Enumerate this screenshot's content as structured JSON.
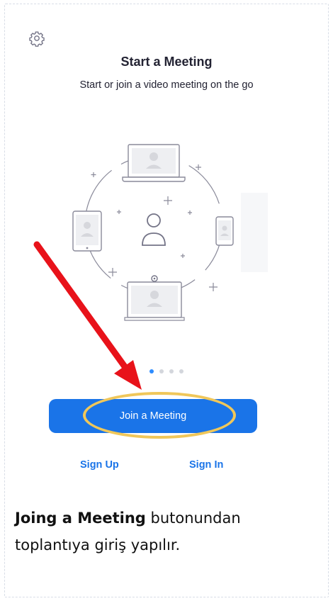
{
  "header": {
    "settings_icon": "gear-icon"
  },
  "main": {
    "title": "Start a Meeting",
    "subtitle": "Start or join a video meeting on the go"
  },
  "illustration": {
    "icons": [
      "laptop-icon",
      "tablet-icon",
      "person-icon",
      "phone-icon",
      "room-display-icon",
      "plus-icon"
    ]
  },
  "carousel": {
    "dot_count": 4,
    "active_index": 0
  },
  "actions": {
    "join_button_label": "Join a Meeting",
    "signup_label": "Sign Up",
    "signin_label": "Sign In"
  },
  "annotation": {
    "caption_bold": "Joing a Meeting",
    "caption_line1_rest": " butonundan",
    "caption_line2": "toplantıya giriş yapılır."
  },
  "colors": {
    "primary": "#1a74e8",
    "highlight": "#f0c75a",
    "arrow": "#e8121a",
    "icon_gray": "#747487"
  }
}
